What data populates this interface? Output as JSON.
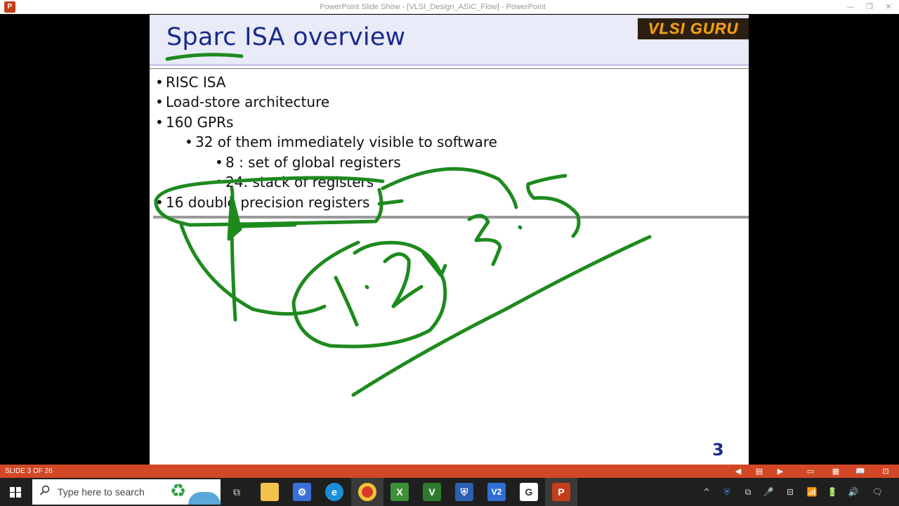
{
  "window": {
    "title": "PowerPoint Slide Show - [VLSI_Design_ASIC_Flow] - PowerPoint",
    "app_icon_letter": "P",
    "minimize": "—",
    "restore": "❐",
    "close": "✕"
  },
  "slide": {
    "title": "Sparc ISA overview",
    "logo_text": "VLSI GURU",
    "bullets": [
      {
        "text": "RISC ISA",
        "level": 1
      },
      {
        "text": "Load-store architecture",
        "level": 1
      },
      {
        "text": "160 GPRs",
        "level": 1
      },
      {
        "text": "32 of them immediately visible to software",
        "level": 2
      },
      {
        "text": "8 : set of global registers",
        "level": 3
      },
      {
        "text": "24: stack of registers",
        "level": 3
      },
      {
        "text": "16 double precision registers",
        "level": 1
      }
    ],
    "bullet_glyph": "•",
    "number": "3"
  },
  "status_bar": {
    "slide_info": "SLIDE 3 OF 26",
    "prev": "◀",
    "notes": "▤",
    "next": "▶",
    "normal_view": "▭",
    "sorter_view": "▦",
    "reading_view": "📖",
    "slideshow_view": "⊡"
  },
  "taskbar": {
    "search_placeholder": "Type here to search",
    "apps": [
      {
        "name": "task-view",
        "glyph": "⧉"
      },
      {
        "name": "file-explorer",
        "glyph": "📁"
      },
      {
        "name": "network-app",
        "glyph": "⚙"
      },
      {
        "name": "edge",
        "glyph": "e"
      },
      {
        "name": "chrome",
        "glyph": "◉"
      },
      {
        "name": "excel-like",
        "glyph": "X"
      },
      {
        "name": "vim",
        "glyph": "V"
      },
      {
        "name": "defender",
        "glyph": "⛨"
      },
      {
        "name": "vscode-like",
        "glyph": "V2"
      },
      {
        "name": "google",
        "glyph": "G"
      },
      {
        "name": "powerpoint",
        "glyph": "P"
      }
    ],
    "tray": [
      "^",
      "⛨",
      "⧉",
      "🎤",
      "⊟",
      "📶",
      "🔋",
      "🔊",
      "🗨"
    ]
  },
  "colors": {
    "ink": "#1e8a1e",
    "title": "#1a2a8a",
    "status_bar": "#d24726"
  }
}
